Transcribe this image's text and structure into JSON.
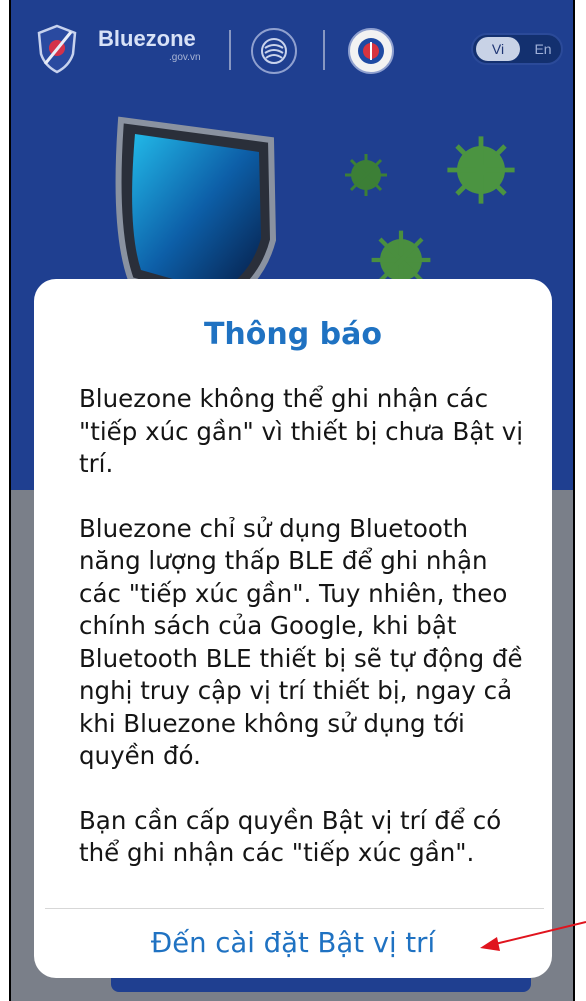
{
  "header": {
    "brand_name": "Bluezone",
    "brand_domain": ".gov.vn",
    "icons": [
      "bluezone-logo-icon",
      "ministry-emblem-icon",
      "health-ministry-emblem-icon"
    ],
    "language": {
      "vi_label": "Vi",
      "en_label": "En",
      "selected": "Vi"
    }
  },
  "dialog": {
    "title": "Thông báo",
    "paragraph_1": "Bluezone không thể ghi nhận các \"tiếp xúc gần\" vì thiết bị chưa Bật vị trí.",
    "paragraph_2": "Bluezone chỉ sử dụng Bluetooth năng lượng thấp BLE để ghi nhận các \"tiếp xúc gần\". Tuy nhiên, theo chính sách của Google, khi bật Bluetooth BLE thiết bị sẽ tự động đề nghị truy cập vị trí thiết bị, ngay cả khi Bluezone không sử dụng tới quyền đó.",
    "paragraph_3": "Bạn cần cấp quyền Bật vị trí để có thể ghi nhận các \"tiếp xúc gần\".",
    "action_label": "Đến cài đặt Bật vị trí"
  },
  "colors": {
    "background": "#1f3f90",
    "accent": "#1f72c2",
    "annotation_arrow": "#e0141e"
  }
}
